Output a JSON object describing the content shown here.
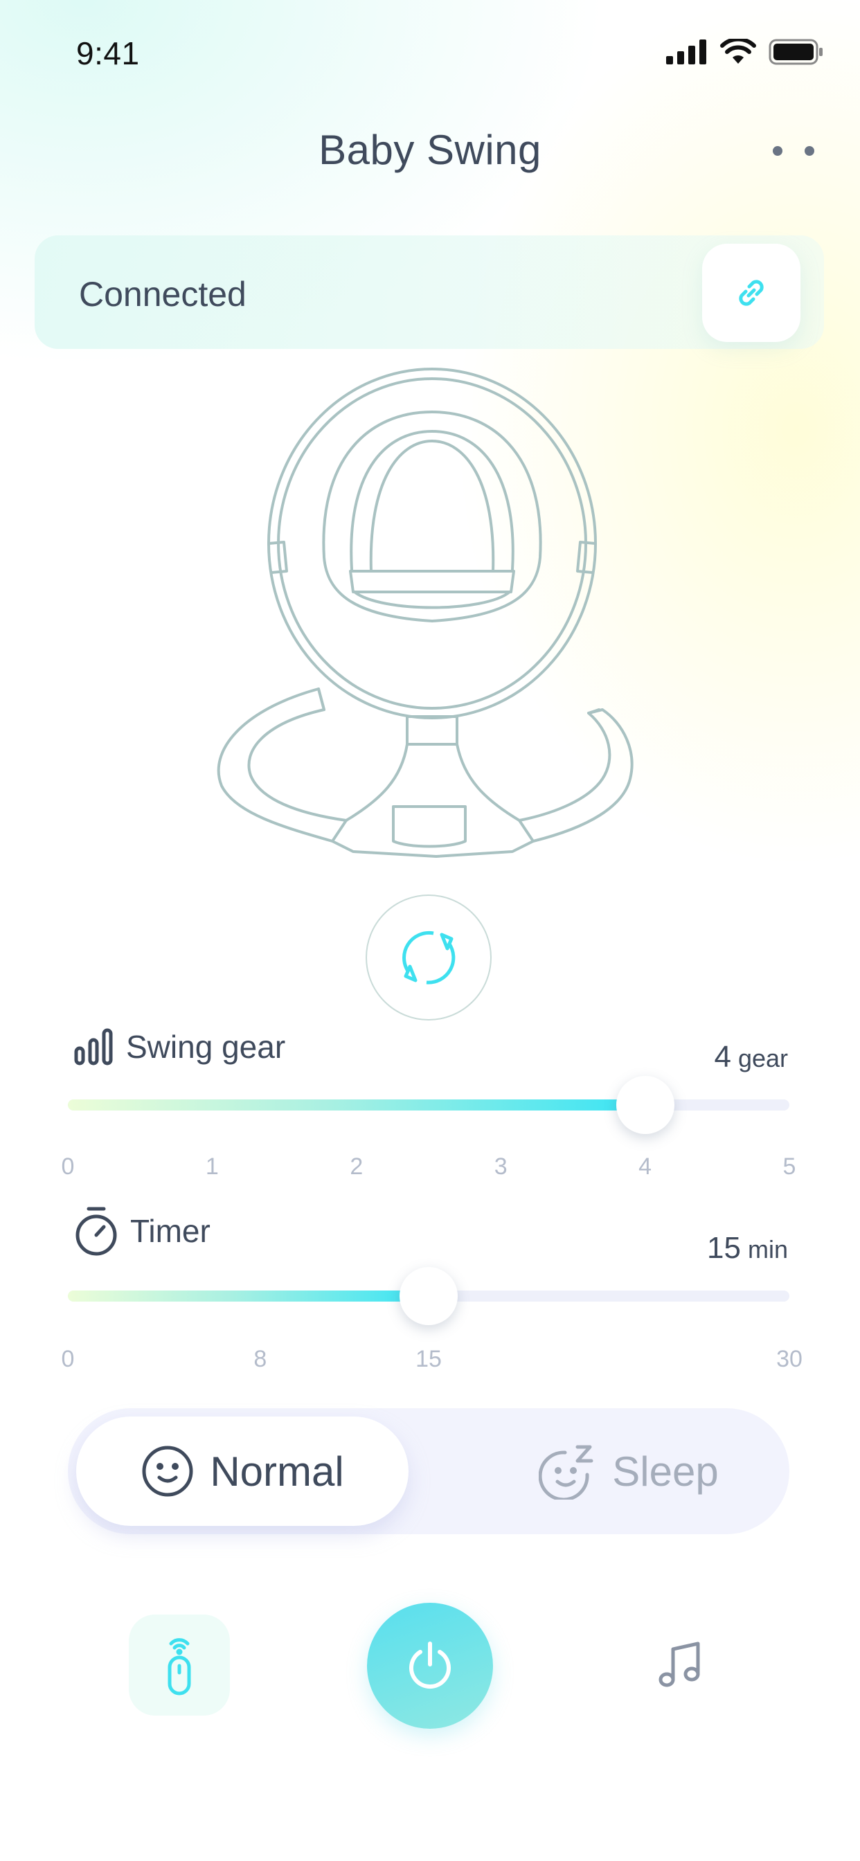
{
  "status_bar": {
    "time": "9:41",
    "icons": [
      "cellular-signal-icon",
      "wifi-icon",
      "battery-icon"
    ]
  },
  "header": {
    "title": "Baby Swing",
    "more_icon": "more-dots-icon"
  },
  "connection": {
    "label": "Connected",
    "icon": "link-icon"
  },
  "illustration": {
    "name": "baby-swing-illustration",
    "rotate_icon": "rotate-icon"
  },
  "swing_gear": {
    "label": "Swing gear",
    "icon": "signal-bars-icon",
    "value": "4",
    "unit": "gear",
    "ticks": [
      "0",
      "1",
      "2",
      "3",
      "4",
      "5"
    ],
    "current": 4,
    "max": 5
  },
  "timer": {
    "label": "Timer",
    "icon": "stopwatch-icon",
    "value": "15",
    "unit": "min",
    "ticks": [
      "0",
      "8",
      "15",
      "30"
    ],
    "current": 15,
    "max": 30
  },
  "mode": {
    "options": [
      {
        "label": "Normal",
        "icon": "smile-face-icon",
        "selected": true
      },
      {
        "label": "Sleep",
        "icon": "sleep-face-icon",
        "selected": false
      }
    ]
  },
  "bottom_bar": {
    "remote_icon": "remote-control-icon",
    "power_icon": "power-icon",
    "music_icon": "music-note-icon"
  },
  "colors": {
    "accent": "#38e4f4",
    "text": "#3f4a5c",
    "muted": "#a5adbb",
    "illustration_stroke": "#a9c2c2"
  }
}
